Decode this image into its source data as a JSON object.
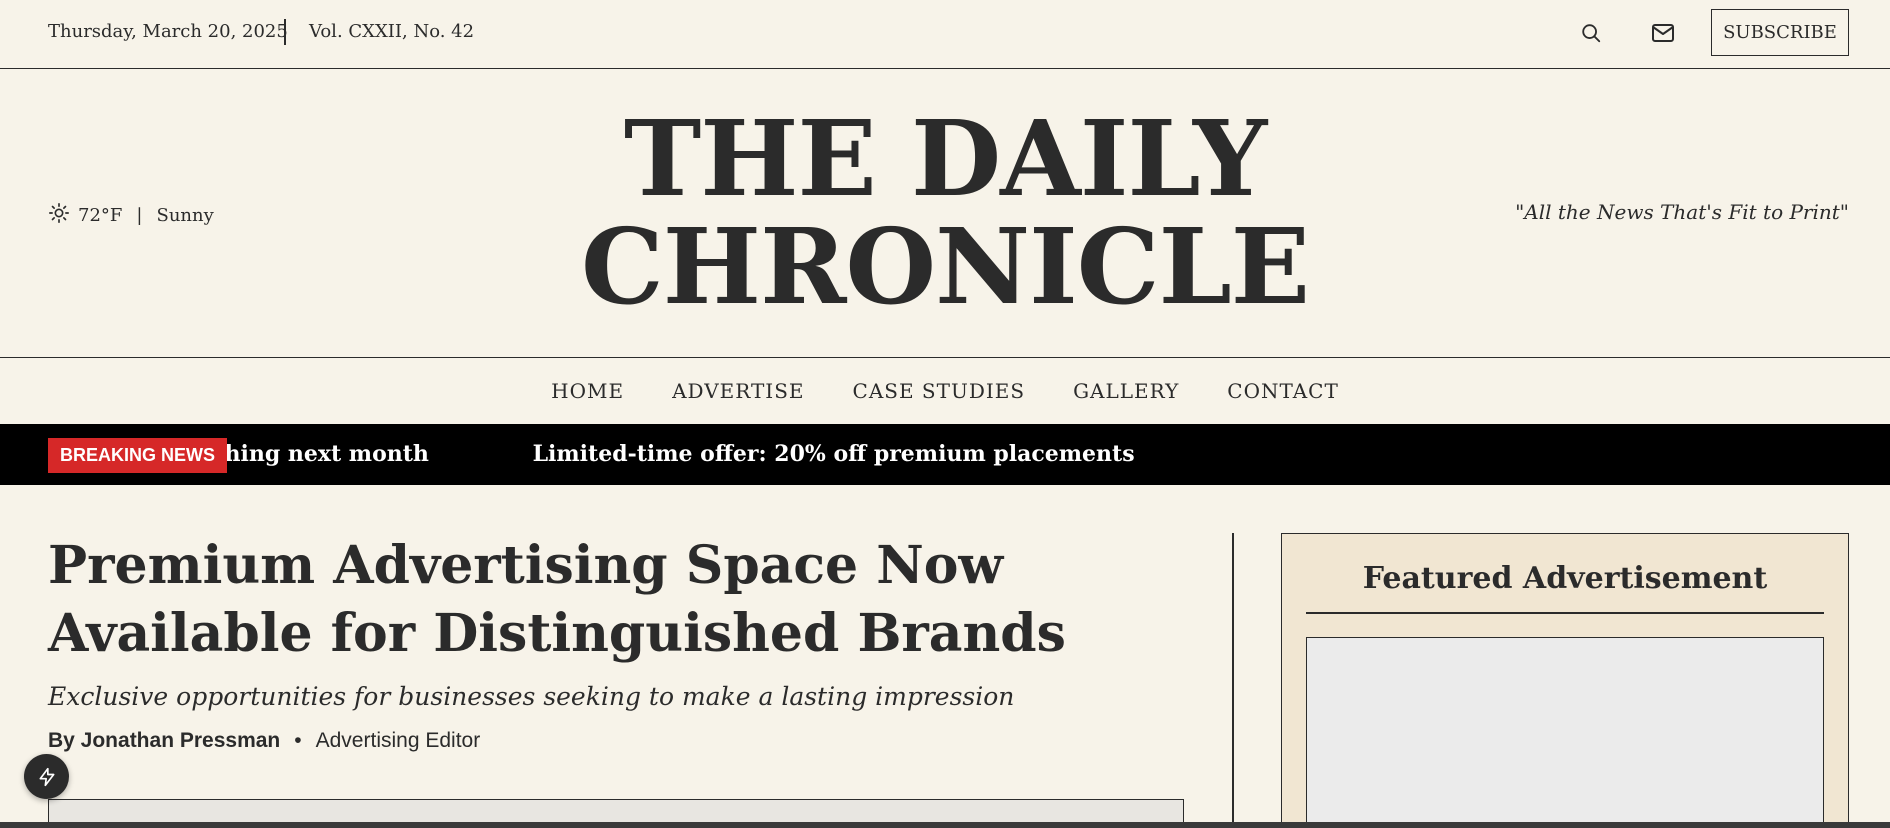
{
  "topbar": {
    "date": "Thursday, March 20, 2025",
    "volume": "Vol. CXXII, No. 42",
    "search_icon": "search-icon",
    "mail_icon": "mail-icon",
    "subscribe_label": "SUBSCRIBE"
  },
  "masthead": {
    "weather_icon": "sun-icon",
    "temperature": "72°F",
    "separator": "|",
    "condition": "Sunny",
    "title_line1": "THE DAILY",
    "title_line2": "CHRONICLE",
    "tagline": "\"All the News That's Fit to Print\""
  },
  "nav": {
    "items": [
      "HOME",
      "ADVERTISE",
      "CASE STUDIES",
      "GALLERY",
      "CONTACT"
    ]
  },
  "breaking": {
    "badge": "BREAKING NEWS",
    "items": [
      "New ad formats launching next month",
      "Limited-time offer: 20% off premium placements"
    ]
  },
  "article": {
    "headline_line1": "Premium Advertising Space Now",
    "headline_line2": "Available for Distinguished Brands",
    "subhead": "Exclusive opportunities for businesses seeking to make a lasting impression",
    "author": "By Jonathan Pressman",
    "bullet": "•",
    "role": "Advertising Editor"
  },
  "sidebar": {
    "title": "Featured Advertisement"
  },
  "fab": {
    "icon": "lightning-icon"
  },
  "colors": {
    "background": "#f7f3e9",
    "text": "#2b2b2b",
    "breaking_bg": "#000000",
    "badge_red": "#d62828",
    "sidebar_bg": "#f1e6d2",
    "placeholder": "#ebebeb"
  }
}
